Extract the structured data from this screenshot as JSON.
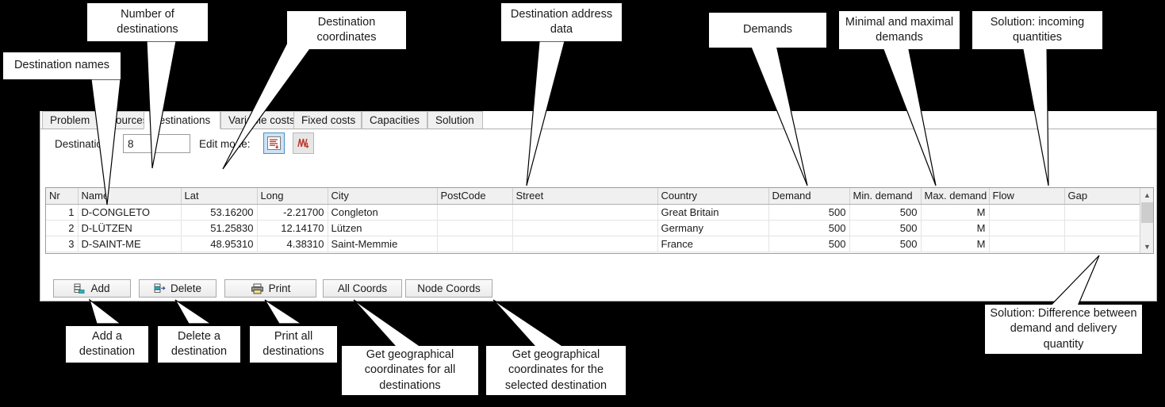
{
  "window": {
    "tabs": [
      {
        "label": "Problem",
        "active": false
      },
      {
        "label": "Sources",
        "active": false
      },
      {
        "label": "Destinations",
        "active": true
      },
      {
        "label": "Variable costs",
        "active": false
      },
      {
        "label": "Fixed costs",
        "active": false
      },
      {
        "label": "Capacities",
        "active": false
      },
      {
        "label": "Solution",
        "active": false
      }
    ]
  },
  "toolbar": {
    "destinations_label": "Destinations",
    "destinations_count": "8",
    "edit_mode_label": "Edit mode:",
    "mode_table_icon": "table-edit-icon",
    "mode_chart_icon": "chart-edit-icon"
  },
  "grid": {
    "columns": [
      "Nr",
      "Name",
      "Lat",
      "Long",
      "City",
      "PostCode",
      "Street",
      "Country",
      "Demand",
      "Min. demand",
      "Max. demand",
      "Flow",
      "Gap"
    ],
    "rows": [
      {
        "nr": "1",
        "name": "D-CONGLETO",
        "lat": "53.16200",
        "long": "-2.21700",
        "city": "Congleton",
        "postcode": "",
        "street": "",
        "country": "Great Britain",
        "demand": "500",
        "min_demand": "500",
        "max_demand": "M",
        "flow": "",
        "gap": "",
        "selected": true
      },
      {
        "nr": "2",
        "name": "D-LÜTZEN",
        "lat": "51.25830",
        "long": "12.14170",
        "city": "Lützen",
        "postcode": "",
        "street": "",
        "country": "Germany",
        "demand": "500",
        "min_demand": "500",
        "max_demand": "M",
        "flow": "",
        "gap": "",
        "selected": false
      },
      {
        "nr": "3",
        "name": "D-SAINT-ME",
        "lat": "48.95310",
        "long": "4.38310",
        "city": "Saint-Memmie",
        "postcode": "",
        "street": "",
        "country": "France",
        "demand": "500",
        "min_demand": "500",
        "max_demand": "M",
        "flow": "",
        "gap": "",
        "selected": false
      }
    ],
    "scrollbar": {
      "up_glyph": "▲",
      "down_glyph": "▼"
    }
  },
  "buttons": [
    {
      "label": "Add",
      "icon": "add-row-icon"
    },
    {
      "label": "Delete",
      "icon": "delete-row-icon"
    },
    {
      "label": "Print",
      "icon": "printer-icon"
    },
    {
      "label": "All Coords",
      "icon": ""
    },
    {
      "label": "Node Coords",
      "icon": ""
    }
  ],
  "callouts": [
    {
      "id": "destination-names",
      "text": "Destination names"
    },
    {
      "id": "number-of-destinations",
      "text": "Number of destinations"
    },
    {
      "id": "destination-coordinates",
      "text": "Destination coordinates"
    },
    {
      "id": "destination-address-data",
      "text": "Destination address data"
    },
    {
      "id": "demands",
      "text": "Demands"
    },
    {
      "id": "min-max-demands",
      "text": "Minimal and maximal demands"
    },
    {
      "id": "solution-incoming",
      "text": "Solution: incoming quantities"
    },
    {
      "id": "add-a-destination",
      "text": "Add a destination"
    },
    {
      "id": "delete-a-destination",
      "text": "Delete a destination"
    },
    {
      "id": "print-all-destinations",
      "text": "Print all destinations"
    },
    {
      "id": "coords-all",
      "text": "Get geographical coordinates for all destinations"
    },
    {
      "id": "coords-selected",
      "text": "Get geographical coordinates for the selected destination"
    },
    {
      "id": "solution-difference",
      "text": "Solution: Difference between demand and delivery quantity"
    }
  ],
  "colors": {
    "background": "#000000",
    "panel": "#ffffff",
    "selection": "#a7c4dd",
    "solution_cell": "#fffceb",
    "accent_icon_red": "#c0392b",
    "accent_icon_blue": "#4a90c4"
  }
}
